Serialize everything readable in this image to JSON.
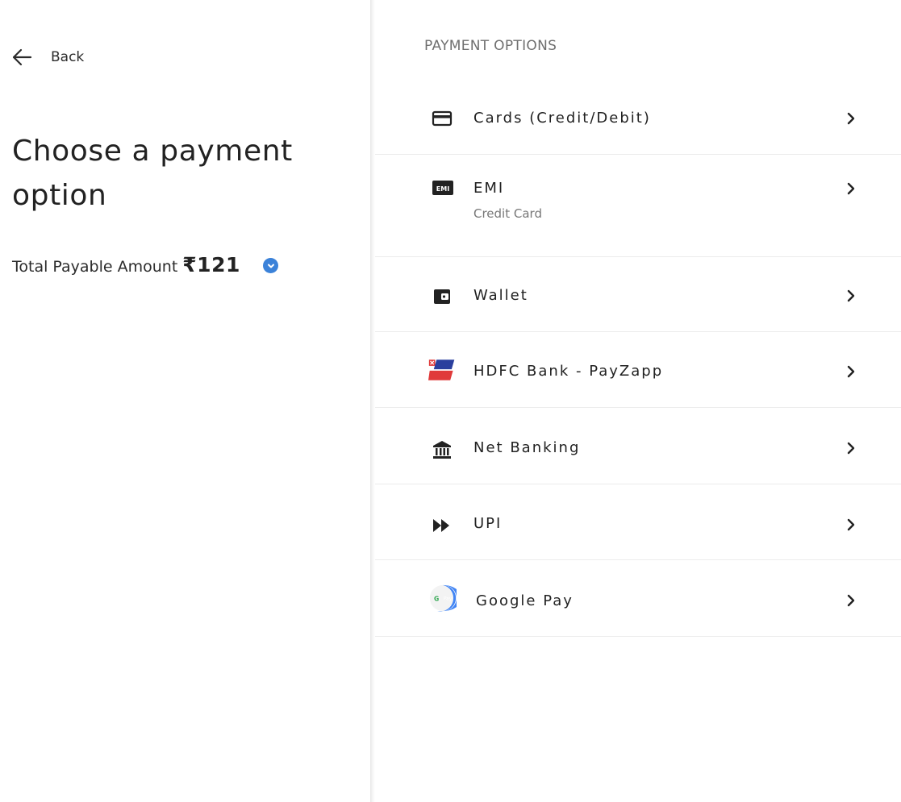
{
  "back_label": "Back",
  "title": "Choose a payment option",
  "total": {
    "label": "Total Payable Amount",
    "amount": "₹121"
  },
  "section_title": "PAYMENT OPTIONS",
  "options": [
    {
      "label": "Cards (Credit/Debit)",
      "icon": "credit-card-icon"
    },
    {
      "label": "EMI",
      "sub": "Credit Card",
      "icon": "emi-icon"
    },
    {
      "label": "Wallet",
      "icon": "wallet-icon"
    },
    {
      "label": "HDFC Bank - PayZapp",
      "icon": "payzapp-logo"
    },
    {
      "label": "Net Banking",
      "icon": "bank-icon"
    },
    {
      "label": "UPI",
      "icon": "upi-icon"
    },
    {
      "label": "Google Pay",
      "icon": "google-pay-icon"
    }
  ],
  "colors": {
    "accent": "#3b82d9",
    "payzapp_red": "#e03a3a",
    "payzapp_blue": "#2a3f9e",
    "gpay_blue": "#4285f4"
  }
}
